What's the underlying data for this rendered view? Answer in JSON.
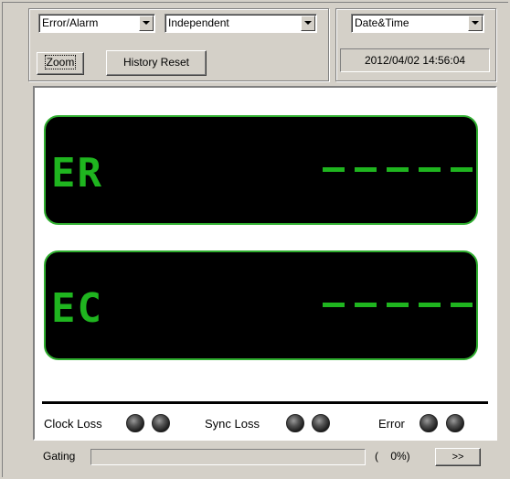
{
  "toolbar": {
    "mode_select": "Error/Alarm",
    "measure_select": "Independent",
    "time_select": "Date&Time",
    "zoom_label": "Zoom",
    "history_reset_label": "History Reset",
    "datetime_value": "2012/04/02 14:56:04"
  },
  "displays": [
    {
      "label": "ER",
      "value": "-----"
    },
    {
      "label": "EC",
      "value": "-----"
    }
  ],
  "indicators": [
    {
      "label": "Clock Loss",
      "led_count": 2,
      "state": "off"
    },
    {
      "label": "Sync Loss",
      "led_count": 2,
      "state": "off"
    },
    {
      "label": "Error",
      "led_count": 2,
      "state": "off"
    }
  ],
  "gating": {
    "label": "Gating",
    "percent_text": "(    0%)",
    "progress": 0,
    "next_label": ">>"
  },
  "colors": {
    "lcd_green": "#1fb51f",
    "lcd_background": "#000000",
    "window_face": "#d4d0c8"
  }
}
